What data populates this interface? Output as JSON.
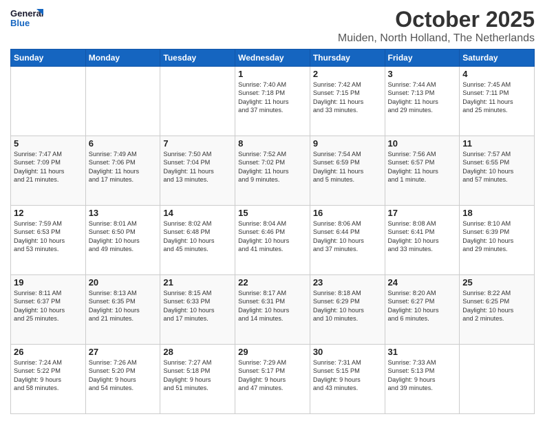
{
  "logo": {
    "line1": "General",
    "line2": "Blue"
  },
  "title": "October 2025",
  "subtitle": "Muiden, North Holland, The Netherlands",
  "days_of_week": [
    "Sunday",
    "Monday",
    "Tuesday",
    "Wednesday",
    "Thursday",
    "Friday",
    "Saturday"
  ],
  "weeks": [
    [
      {
        "day": "",
        "info": ""
      },
      {
        "day": "",
        "info": ""
      },
      {
        "day": "",
        "info": ""
      },
      {
        "day": "1",
        "info": "Sunrise: 7:40 AM\nSunset: 7:18 PM\nDaylight: 11 hours\nand 37 minutes."
      },
      {
        "day": "2",
        "info": "Sunrise: 7:42 AM\nSunset: 7:15 PM\nDaylight: 11 hours\nand 33 minutes."
      },
      {
        "day": "3",
        "info": "Sunrise: 7:44 AM\nSunset: 7:13 PM\nDaylight: 11 hours\nand 29 minutes."
      },
      {
        "day": "4",
        "info": "Sunrise: 7:45 AM\nSunset: 7:11 PM\nDaylight: 11 hours\nand 25 minutes."
      }
    ],
    [
      {
        "day": "5",
        "info": "Sunrise: 7:47 AM\nSunset: 7:09 PM\nDaylight: 11 hours\nand 21 minutes."
      },
      {
        "day": "6",
        "info": "Sunrise: 7:49 AM\nSunset: 7:06 PM\nDaylight: 11 hours\nand 17 minutes."
      },
      {
        "day": "7",
        "info": "Sunrise: 7:50 AM\nSunset: 7:04 PM\nDaylight: 11 hours\nand 13 minutes."
      },
      {
        "day": "8",
        "info": "Sunrise: 7:52 AM\nSunset: 7:02 PM\nDaylight: 11 hours\nand 9 minutes."
      },
      {
        "day": "9",
        "info": "Sunrise: 7:54 AM\nSunset: 6:59 PM\nDaylight: 11 hours\nand 5 minutes."
      },
      {
        "day": "10",
        "info": "Sunrise: 7:56 AM\nSunset: 6:57 PM\nDaylight: 11 hours\nand 1 minute."
      },
      {
        "day": "11",
        "info": "Sunrise: 7:57 AM\nSunset: 6:55 PM\nDaylight: 10 hours\nand 57 minutes."
      }
    ],
    [
      {
        "day": "12",
        "info": "Sunrise: 7:59 AM\nSunset: 6:53 PM\nDaylight: 10 hours\nand 53 minutes."
      },
      {
        "day": "13",
        "info": "Sunrise: 8:01 AM\nSunset: 6:50 PM\nDaylight: 10 hours\nand 49 minutes."
      },
      {
        "day": "14",
        "info": "Sunrise: 8:02 AM\nSunset: 6:48 PM\nDaylight: 10 hours\nand 45 minutes."
      },
      {
        "day": "15",
        "info": "Sunrise: 8:04 AM\nSunset: 6:46 PM\nDaylight: 10 hours\nand 41 minutes."
      },
      {
        "day": "16",
        "info": "Sunrise: 8:06 AM\nSunset: 6:44 PM\nDaylight: 10 hours\nand 37 minutes."
      },
      {
        "day": "17",
        "info": "Sunrise: 8:08 AM\nSunset: 6:41 PM\nDaylight: 10 hours\nand 33 minutes."
      },
      {
        "day": "18",
        "info": "Sunrise: 8:10 AM\nSunset: 6:39 PM\nDaylight: 10 hours\nand 29 minutes."
      }
    ],
    [
      {
        "day": "19",
        "info": "Sunrise: 8:11 AM\nSunset: 6:37 PM\nDaylight: 10 hours\nand 25 minutes."
      },
      {
        "day": "20",
        "info": "Sunrise: 8:13 AM\nSunset: 6:35 PM\nDaylight: 10 hours\nand 21 minutes."
      },
      {
        "day": "21",
        "info": "Sunrise: 8:15 AM\nSunset: 6:33 PM\nDaylight: 10 hours\nand 17 minutes."
      },
      {
        "day": "22",
        "info": "Sunrise: 8:17 AM\nSunset: 6:31 PM\nDaylight: 10 hours\nand 14 minutes."
      },
      {
        "day": "23",
        "info": "Sunrise: 8:18 AM\nSunset: 6:29 PM\nDaylight: 10 hours\nand 10 minutes."
      },
      {
        "day": "24",
        "info": "Sunrise: 8:20 AM\nSunset: 6:27 PM\nDaylight: 10 hours\nand 6 minutes."
      },
      {
        "day": "25",
        "info": "Sunrise: 8:22 AM\nSunset: 6:25 PM\nDaylight: 10 hours\nand 2 minutes."
      }
    ],
    [
      {
        "day": "26",
        "info": "Sunrise: 7:24 AM\nSunset: 5:22 PM\nDaylight: 9 hours\nand 58 minutes."
      },
      {
        "day": "27",
        "info": "Sunrise: 7:26 AM\nSunset: 5:20 PM\nDaylight: 9 hours\nand 54 minutes."
      },
      {
        "day": "28",
        "info": "Sunrise: 7:27 AM\nSunset: 5:18 PM\nDaylight: 9 hours\nand 51 minutes."
      },
      {
        "day": "29",
        "info": "Sunrise: 7:29 AM\nSunset: 5:17 PM\nDaylight: 9 hours\nand 47 minutes."
      },
      {
        "day": "30",
        "info": "Sunrise: 7:31 AM\nSunset: 5:15 PM\nDaylight: 9 hours\nand 43 minutes."
      },
      {
        "day": "31",
        "info": "Sunrise: 7:33 AM\nSunset: 5:13 PM\nDaylight: 9 hours\nand 39 minutes."
      },
      {
        "day": "",
        "info": ""
      }
    ]
  ]
}
